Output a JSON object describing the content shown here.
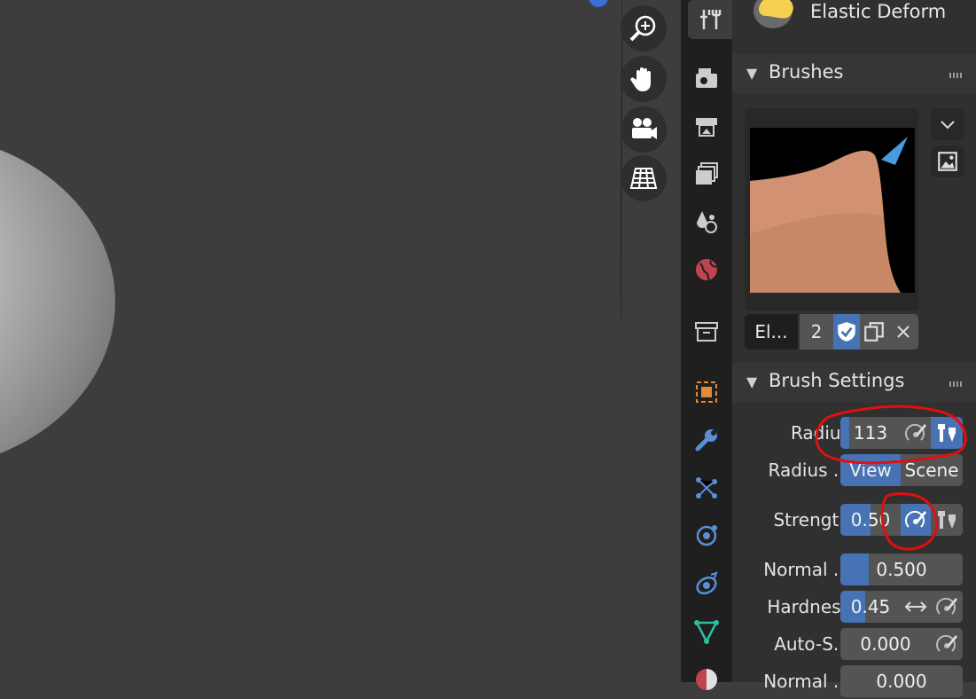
{
  "tool": {
    "name": "Elastic Deform"
  },
  "sections": {
    "brushes": {
      "title": "Brushes"
    },
    "brush_settings": {
      "title": "Brush Settings"
    }
  },
  "brush": {
    "name": "El...",
    "users": "2"
  },
  "properties": {
    "radius": {
      "label": "Radius",
      "value": "113"
    },
    "radius_unit": {
      "label": "Radius ...",
      "options": [
        "View",
        "Scene"
      ],
      "selected": "View"
    },
    "strength": {
      "label": "Strength",
      "value": "0.50"
    },
    "normal_weight": {
      "label": "Normal ...",
      "value": "0.500",
      "fraction": 0.5
    },
    "hardness": {
      "label": "Hardness",
      "value": "0.45",
      "fraction": 0.45
    },
    "auto_smooth": {
      "label": "Auto-S...",
      "value": "0.000"
    },
    "normal_radius": {
      "label": "Normal ...",
      "value": "0.000"
    }
  },
  "nav_gizmos": [
    "zoom-icon",
    "hand-pan-icon",
    "camera-icon",
    "grid-perspective-icon"
  ],
  "tabs": [
    "tool-icon",
    "render-icon",
    "output-icon",
    "view-layer-icon",
    "scene-icon",
    "world-icon",
    "collection-icon",
    "object-icon",
    "modifier-icon",
    "particles-icon",
    "physics-icon",
    "constraints-icon",
    "data-icon",
    "material-icon"
  ],
  "colors": {
    "accent": "#4772b3",
    "annotation": "#e01010"
  }
}
